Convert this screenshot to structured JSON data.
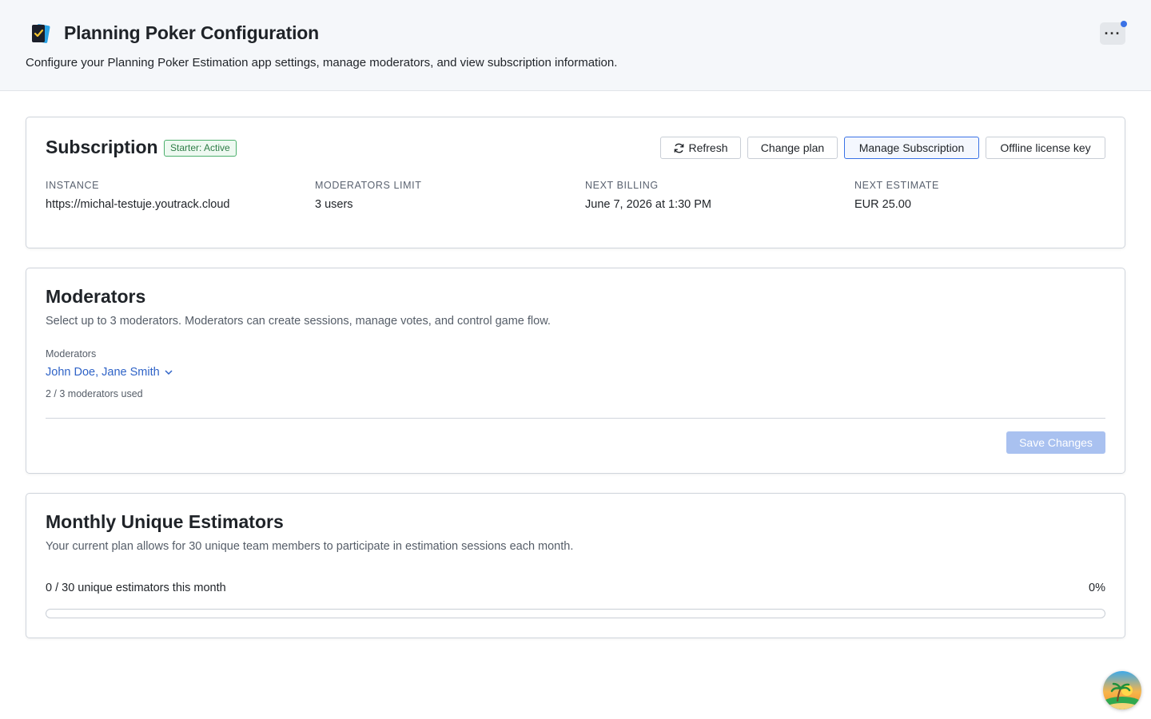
{
  "header": {
    "title": "Planning Poker Configuration",
    "description": "Configure your Planning Poker Estimation app settings, manage moderators, and view subscription information.",
    "logo_icon": "planning-poker-cards-icon",
    "more_icon": "more-horizontal-icon"
  },
  "subscription": {
    "title": "Subscription",
    "status_badge": "Starter: Active",
    "buttons": {
      "refresh": "Refresh",
      "change_plan": "Change plan",
      "manage": "Manage Subscription",
      "offline_key": "Offline license key"
    },
    "info": [
      {
        "label": "INSTANCE",
        "value": "https://michal-testuje.youtrack.cloud"
      },
      {
        "label": "MODERATORS LIMIT",
        "value": "3 users"
      },
      {
        "label": "NEXT BILLING",
        "value": "June 7, 2026 at 1:30 PM"
      },
      {
        "label": "NEXT ESTIMATE",
        "value": "EUR 25.00"
      }
    ]
  },
  "moderators": {
    "title": "Moderators",
    "description": "Select up to 3 moderators. Moderators can create sessions, manage votes, and control game flow.",
    "field_label": "Moderators",
    "selected": "John Doe, Jane Smith",
    "hint": "2 / 3 moderators used",
    "save_label": "Save Changes"
  },
  "estimators": {
    "title": "Monthly Unique Estimators",
    "description": "Your current plan allows for 30 unique team members to participate in estimation sessions each month.",
    "usage_text": "0 / 30 unique estimators this month",
    "usage_percent": "0%",
    "progress_fraction": 0
  },
  "colors": {
    "accent": "#3a72e6",
    "badge_green": "#2e7d47",
    "save_disabled": "#a9c1f0"
  }
}
